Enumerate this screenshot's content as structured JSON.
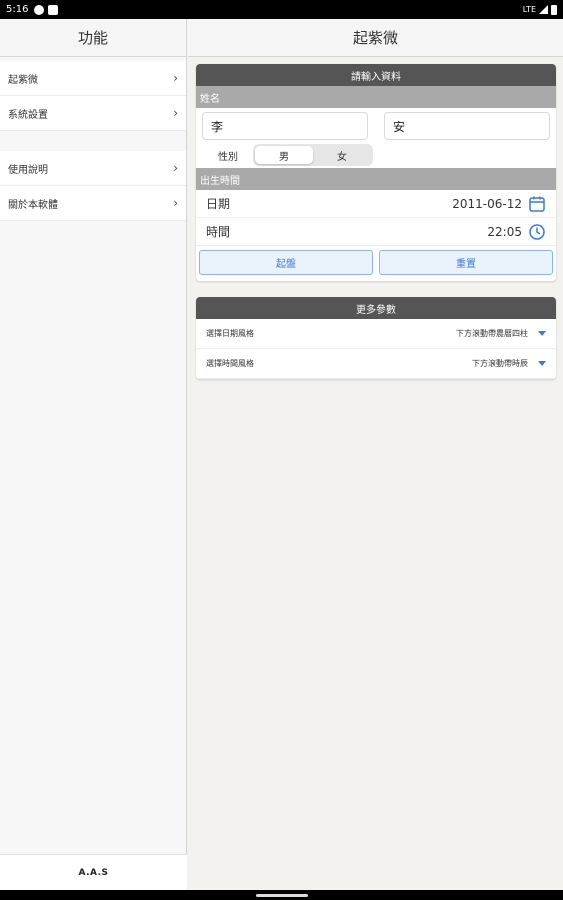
{
  "status": {
    "time": "5:16",
    "network": "LTE"
  },
  "sidebar": {
    "title": "功能",
    "groups": [
      {
        "items": [
          {
            "label": "起紫微"
          },
          {
            "label": "系統設置"
          }
        ]
      },
      {
        "items": [
          {
            "label": "使用說明"
          },
          {
            "label": "關於本軟體"
          }
        ]
      }
    ],
    "footer": "A.A.S"
  },
  "main": {
    "title": "起紫微",
    "input_card": {
      "title": "請輸入資料",
      "name_label": "姓名",
      "surname_value": "李",
      "given_name_value": "安",
      "gender_label": "性別",
      "gender_options": [
        "男",
        "女"
      ],
      "gender_selected": "男",
      "birth_label": "出生時間",
      "date_label": "日期",
      "date_value": "2011-06-12",
      "time_label": "時間",
      "time_value": "22:05",
      "start_button": "起盤",
      "reset_button": "重置"
    },
    "params_card": {
      "title": "更多參數",
      "rows": [
        {
          "label": "選擇日期風格",
          "value": "下方滾動帶農曆四柱"
        },
        {
          "label": "選擇時間風格",
          "value": "下方滾動帶時辰"
        }
      ]
    }
  },
  "colors": {
    "accent": "#3a7bd5",
    "card_header": "#555555",
    "section_header": "#a9a9a9"
  }
}
